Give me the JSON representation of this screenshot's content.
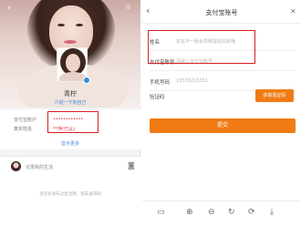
{
  "profile": {
    "name": "青柠",
    "intro_link": "介绍一下你自己",
    "alipay_label": "支付宝账户",
    "alipay_value": "••••••••••••",
    "realname_label": "真实姓名",
    "realname_value": "**萍(已认)",
    "show_more": "显示更多"
  },
  "feed": {
    "prompt": "记录我的生活",
    "empty_text": "还没有发布过生活哦，快去发布吧"
  },
  "form": {
    "title": "支付宝账号",
    "name_label": "姓名",
    "name_placeholder": "实名不一致会导致提现失败哦",
    "account_label": "支付宝账号",
    "account_placeholder": "请输入支付宝账号",
    "phone_label": "手机号码",
    "phone_value": "15530215251",
    "code_label": "验证码",
    "code_placeholder": "",
    "sms_button": "获取验证码",
    "submit_button": "提交"
  },
  "icons": {
    "back": "back-arrow-icon",
    "camera": "camera-icon",
    "close": "close-icon",
    "save": "save-icon",
    "zoom_in": "zoom-in-icon",
    "zoom_out": "zoom-out-icon",
    "rotate": "rotate-icon",
    "refresh": "refresh-icon",
    "download": "download-icon"
  },
  "colors": {
    "accent": "#f07b14",
    "link": "#3b8ad9",
    "highlight_box": "#d62020"
  }
}
